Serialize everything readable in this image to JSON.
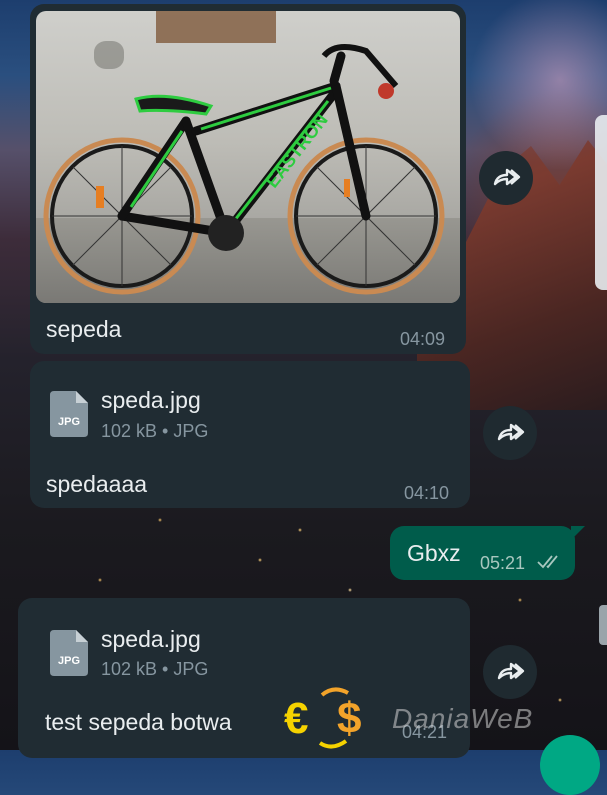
{
  "messages": [
    {
      "type": "image",
      "caption": "sepeda",
      "time": "04:09",
      "photo_label": "EASTRON"
    },
    {
      "type": "document",
      "file_name": "speda.jpg",
      "file_meta": "102 kB • JPG",
      "icon_label": "JPG",
      "caption": "spedaaaa",
      "time": "04:10"
    },
    {
      "type": "outgoing_text",
      "text": "Gbxz",
      "time": "05:21",
      "status": "read"
    },
    {
      "type": "document",
      "file_name": "speda.jpg",
      "file_meta": "102 kB • JPG",
      "icon_label": "JPG",
      "caption": "test sepeda botwa",
      "time": "04:21"
    }
  ],
  "watermark": {
    "text": "DaniaWeB",
    "colors": {
      "orange": "#f2a32a",
      "yellow": "#f5d200"
    }
  },
  "icons": {
    "forward": "forward-icon",
    "read_receipt": "double-check-icon",
    "document": "jpg-file-icon"
  },
  "colors": {
    "incoming_bubble": "#202c33",
    "outgoing_bubble": "#005c4b",
    "time_text": "#8696a0",
    "primary_text": "#e9edef",
    "fab": "#00a884"
  }
}
